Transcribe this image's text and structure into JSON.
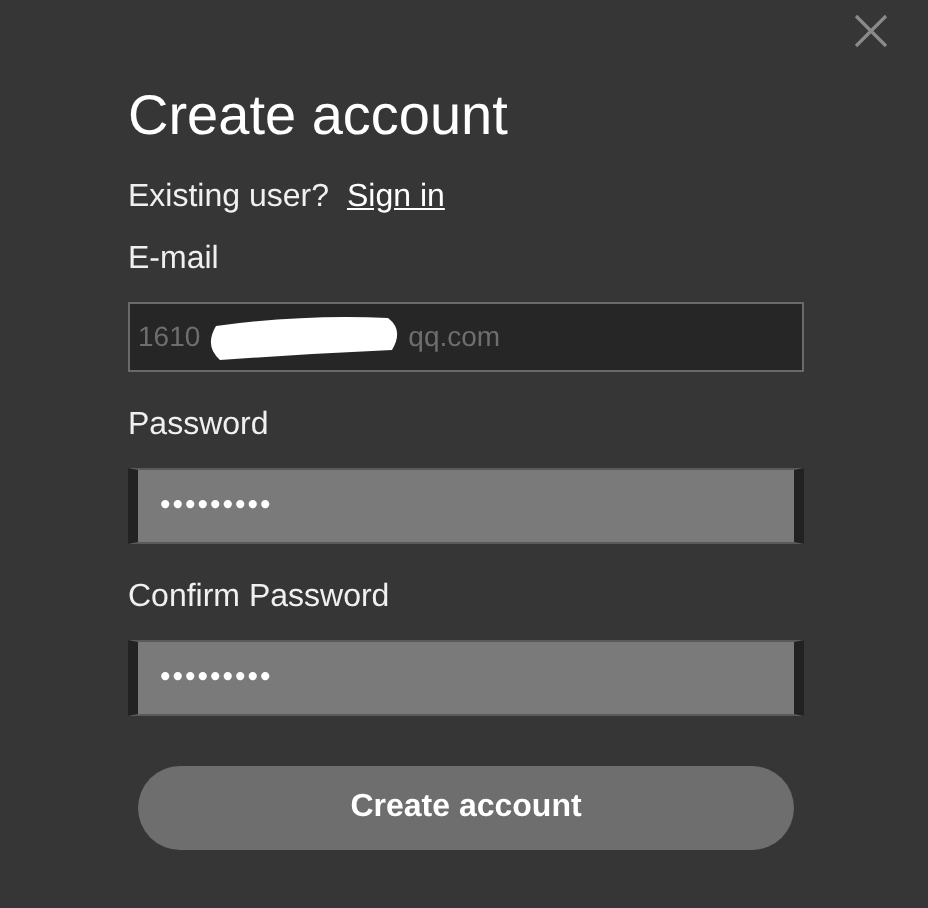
{
  "title": "Create account",
  "existing_user": {
    "prompt": "Existing user?",
    "link": "Sign in"
  },
  "email": {
    "label": "E-mail",
    "value_start": "1610",
    "value_end": "qq.com",
    "redacted": true
  },
  "password": {
    "label": "Password",
    "masked_value": "•••••••••"
  },
  "confirm_password": {
    "label": "Confirm Password",
    "masked_value": "•••••••••"
  },
  "submit_button": "Create account"
}
